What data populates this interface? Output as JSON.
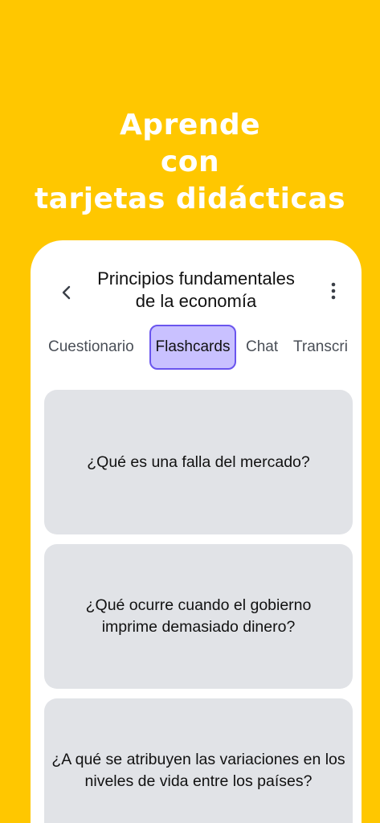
{
  "hero": {
    "line1": "Aprende",
    "line2": "con",
    "line3": "tarjetas didácticas"
  },
  "header": {
    "title_line1": "Principios fundamentales",
    "title_line2": "de la economía",
    "back_icon": "chevron-left-icon",
    "more_icon": "more-vertical-icon"
  },
  "tabs": [
    {
      "label": "Cuestionario",
      "active": false
    },
    {
      "label": "Flashcards",
      "active": true
    },
    {
      "label": "Chat",
      "active": false
    },
    {
      "label": "Transcri",
      "active": false
    }
  ],
  "cards": [
    {
      "question": "¿Qué es una falla del mercado?"
    },
    {
      "question": "¿Qué ocurre cuando el gobierno imprime demasiado dinero?"
    },
    {
      "question": "¿A qué se atribuyen las variaciones en los niveles de vida entre los países?"
    }
  ],
  "colors": {
    "background": "#FFC700",
    "active_tab_fill": "#C9C1FF",
    "active_tab_border": "#6A55EE",
    "card": "#E1E3E7"
  }
}
